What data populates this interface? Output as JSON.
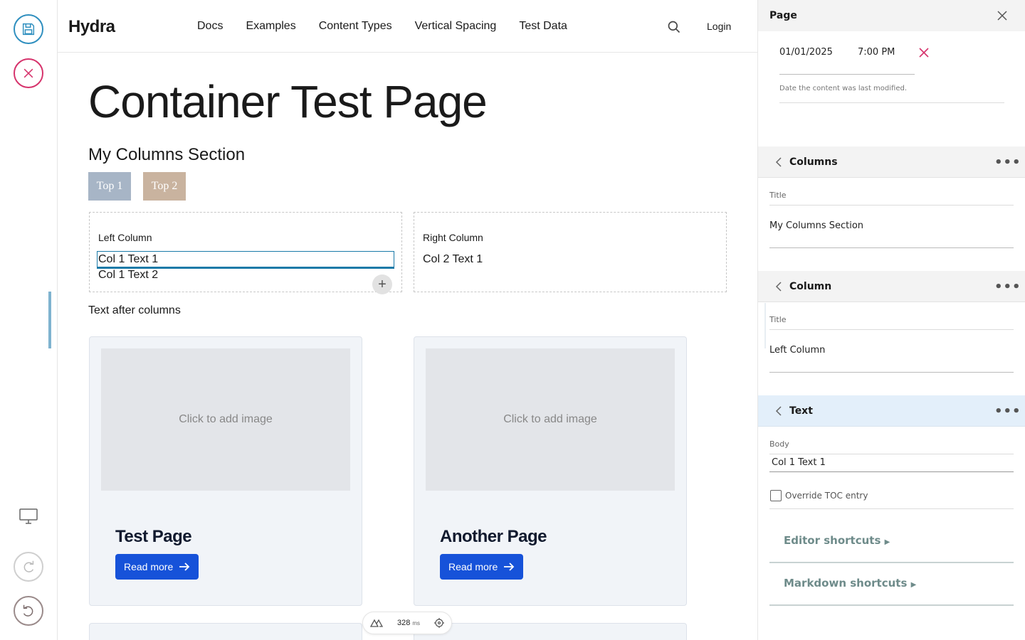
{
  "site": {
    "logo": "Hydra",
    "nav": [
      "Docs",
      "Examples",
      "Content Types",
      "Vertical Spacing",
      "Test Data"
    ],
    "login": "Login"
  },
  "page": {
    "title": "Container Test Page",
    "section_title": "My Columns Section",
    "tags": [
      {
        "label": "Top 1",
        "color": "#a7b5c6"
      },
      {
        "label": "Top 2",
        "color": "#c9b39f"
      }
    ],
    "columns": [
      {
        "label": "Left Column",
        "texts": [
          "Col 1 Text 1",
          "Col 1 Text 2"
        ]
      },
      {
        "label": "Right Column",
        "texts": [
          "Col 2 Text 1"
        ]
      }
    ],
    "after_text": "Text after columns",
    "cards": [
      {
        "image_placeholder": "Click to add image",
        "title": "Test Page",
        "button": "Read more"
      },
      {
        "image_placeholder": "Click to add image",
        "title": "Another Page",
        "button": "Read more"
      }
    ]
  },
  "perf": {
    "value": "328",
    "unit": "ms"
  },
  "sidebar": {
    "page_header": "Page",
    "date": "01/01/2025",
    "time": "7:00 PM",
    "date_help": "Date the content was last modified.",
    "columns_header": "Columns",
    "columns_title_label": "Title",
    "columns_title_value": "My Columns Section",
    "column_header": "Column",
    "column_title_label": "Title",
    "column_title_value": "Left Column",
    "text_header": "Text",
    "body_label": "Body",
    "body_value": "Col 1 Text 1",
    "override_toc": "Override TOC entry",
    "editor_shortcuts": "Editor shortcuts",
    "markdown_shortcuts": "Markdown shortcuts"
  },
  "colors": {
    "accent": "#1a7aa8",
    "primary_button": "#1652d9",
    "cancel": "#d6336c"
  }
}
